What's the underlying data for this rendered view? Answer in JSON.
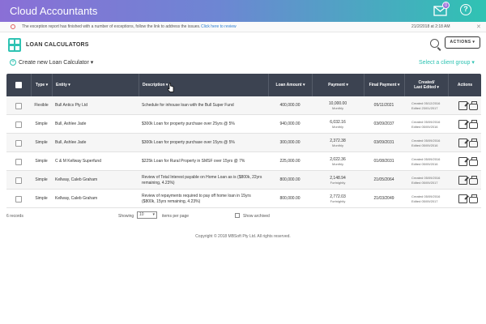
{
  "app": {
    "title": "Cloud Accountants",
    "mail_count": "0",
    "help_glyph": "?"
  },
  "notice": {
    "text": "The exception report has finished with a number of exceptions, follow the link to address the issues.",
    "link": "Click here to review",
    "timestamp": "21/2/2018 at 2:18 AM",
    "close_glyph": "✕"
  },
  "page": {
    "title": "LOAN CALCULATORS",
    "actions_label": "ACTIONS ▾"
  },
  "toolbar": {
    "create_label": "Create new Loan Calculator",
    "create_caret": "▾",
    "client_group_label": "Select a client group ▾"
  },
  "table": {
    "headers": {
      "type": "Type ▾",
      "entity": "Entity ▾",
      "description": "Description ▾",
      "loan_amount": "Loan Amount ▾",
      "payment": "Payment ▾",
      "final_payment": "Final Payment ▾",
      "created_edited_1": "Created/",
      "created_edited_2": "Last Edited ▾",
      "actions": "Actions"
    },
    "rows": [
      {
        "type": "Flexible",
        "entity": "Bull Antics Pty Ltd",
        "description": "Schedule for inhouse loan with the Bull Super Fund",
        "loan_amount": "400,000.00",
        "payment": "10,000.00",
        "frequency": "Monthly",
        "final_payment": "05/11/2021",
        "created": "Created 05/12/2016",
        "edited": "Edited 23/01/2017"
      },
      {
        "type": "Simple",
        "entity": "Bull, Ashlee Jade",
        "description": "$300k Loan for property purchase over 25yrs @ 5%",
        "loan_amount": "940,000.00",
        "payment": "6,032.16",
        "frequency": "Monthly",
        "final_payment": "03/09/2037",
        "created": "Created 05/09/2016",
        "edited": "Edited 05/09/2016"
      },
      {
        "type": "Simple",
        "entity": "Bull, Ashlee Jade",
        "description": "$300k Loan for property purchase over 15yrs @ 5%",
        "loan_amount": "300,000.00",
        "payment": "2,372.38",
        "frequency": "Monthly",
        "final_payment": "03/09/2031",
        "created": "Created 05/09/2016",
        "edited": "Edited 05/09/2016"
      },
      {
        "type": "Simple",
        "entity": "C & M Kellway Superfund",
        "description": "$225k Loan for Rural Property in SMSF over 15yrs @ 7%",
        "loan_amount": "225,000.00",
        "payment": "2,022.36",
        "frequency": "Monthly",
        "final_payment": "01/08/2031",
        "created": "Created 05/09/2016",
        "edited": "Edited 05/09/2016"
      },
      {
        "type": "Simple",
        "entity": "Kellway, Caleb Graham",
        "description": "Review of Total Interest payable on Home Loan as is ($800k, 22yrs remaining, 4.23%)",
        "loan_amount": "800,000.00",
        "payment": "2,148.94",
        "frequency": "Fortnightly",
        "final_payment": "21/05/2064",
        "created": "Created 05/09/2016",
        "edited": "Edited 05/09/2017"
      },
      {
        "type": "Simple",
        "entity": "Kellway, Caleb Graham",
        "description": "Review of repayments required to pay off home loan in 15yrs ($800k, 15yrs remaining, 4.23%)",
        "loan_amount": "800,000.00",
        "payment": "2,772.03",
        "frequency": "Fortnightly",
        "final_payment": "21/03/2049",
        "created": "Created 05/09/2016",
        "edited": "Edited 05/09/2017"
      }
    ]
  },
  "footer": {
    "records": "6 records",
    "showing_label": "Showing",
    "page_size": "10",
    "per_page_label": "items per page",
    "show_archived_label": "Show archived",
    "copyright": "Copyright © 2018 MBSoft Pty Ltd. All rights reserved."
  },
  "colors": {
    "header_gradient_start": "#8a6fd6",
    "header_gradient_end": "#2fc3b3",
    "accent": "#2fc3b3",
    "table_header": "#3c4351",
    "link": "#2a7ccf"
  }
}
